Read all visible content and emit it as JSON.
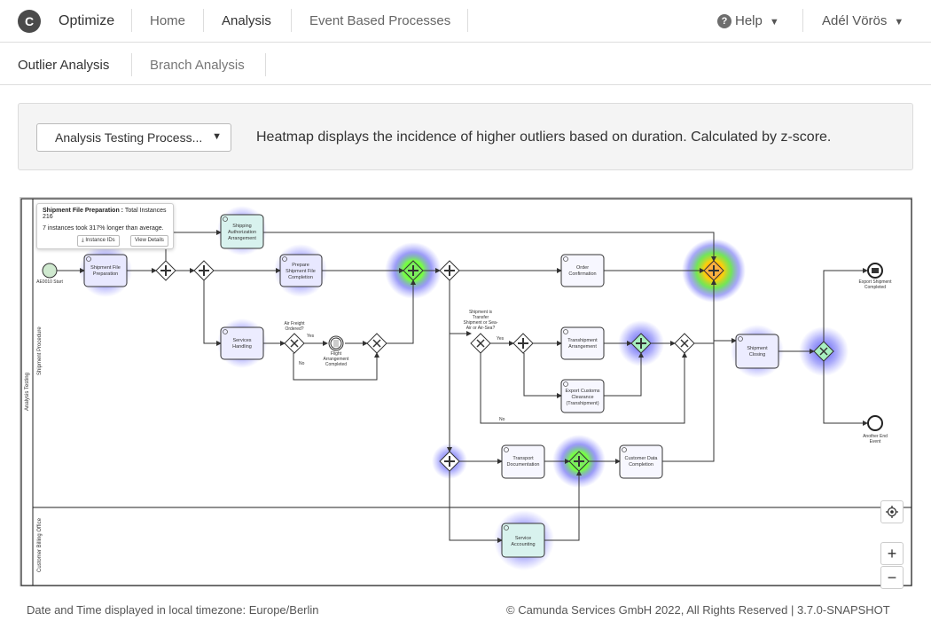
{
  "header": {
    "logo_letter": "C",
    "brand": "Optimize",
    "nav": [
      {
        "label": "Home"
      },
      {
        "label": "Analysis"
      },
      {
        "label": "Event Based Processes"
      }
    ],
    "help_label": "Help",
    "user_label": "Adél Vörös"
  },
  "subnav": {
    "tabs": [
      {
        "label": "Outlier Analysis"
      },
      {
        "label": "Branch Analysis"
      }
    ]
  },
  "controls": {
    "process_select": "Analysis Testing Process...",
    "info": "Heatmap displays the incidence of higher outliers based on duration. Calculated by z-score."
  },
  "tooltip": {
    "title": "Shipment File Preparation :",
    "total": "Total Instances 216",
    "detail": "7 instances took 317% longer than average.",
    "instance_ids_button": "Instance IDs",
    "view_details_button": "View Details"
  },
  "diagram": {
    "pool_label": "Analysis Testing",
    "lanes": [
      "Shipment Procedure",
      "Customer Billing Office"
    ],
    "start_label": "AE0010 Start",
    "tasks": {
      "shipment_file_preparation": [
        "Shipment File",
        "Preparation"
      ],
      "shipping_authorization": [
        "Shipping",
        "Authorization",
        "Arrangement"
      ],
      "prepare_shipment_file_completion": [
        "Prepare",
        "Shipment File",
        "Completion"
      ],
      "services_handling": [
        "Services",
        "Handling"
      ],
      "order_confirmation": [
        "Order",
        "Confirmation"
      ],
      "transhipment_arrangement": [
        "Transhipment",
        "Arrangement"
      ],
      "export_customs_clearance": [
        "Export Customs",
        "Clearance",
        "(Transhipment)"
      ],
      "shipment_closing": [
        "Shipment",
        "Closing"
      ],
      "transport_documentation": [
        "Transport",
        "Documentation"
      ],
      "customer_data_completion": [
        "Customer Data",
        "Completion"
      ],
      "service_accounting": [
        "Service",
        "Accounting"
      ]
    },
    "gateway_labels": {
      "air_freight": [
        "Air Freight",
        "Ordered?"
      ],
      "transfer": [
        "Shipment is",
        "Transfer",
        "Shipment or Sea-",
        "Air or Air-Sea?"
      ]
    },
    "flow_labels": {
      "yes": "Yes",
      "no": "No"
    },
    "intermediate_event_label": [
      "Flight",
      "Arrangement",
      "Completed"
    ],
    "end_events": {
      "export_shipment_completed": [
        "Export Shipment",
        "Completed"
      ],
      "another_end_event": [
        "Another End",
        "Event"
      ]
    },
    "zoom_in": "+",
    "zoom_out": "−"
  },
  "footer": {
    "timezone": "Date and Time displayed in local timezone: Europe/Berlin",
    "copyright": "© Camunda Services GmbH 2022, All Rights Reserved | 3.7.0-SNAPSHOT"
  },
  "colors": {
    "heat_low": "#3a3af0",
    "heat_mid": "#22d022",
    "heat_high": "#ff3300",
    "task_fill": "#f5f5ff",
    "stroke": "#333333"
  }
}
